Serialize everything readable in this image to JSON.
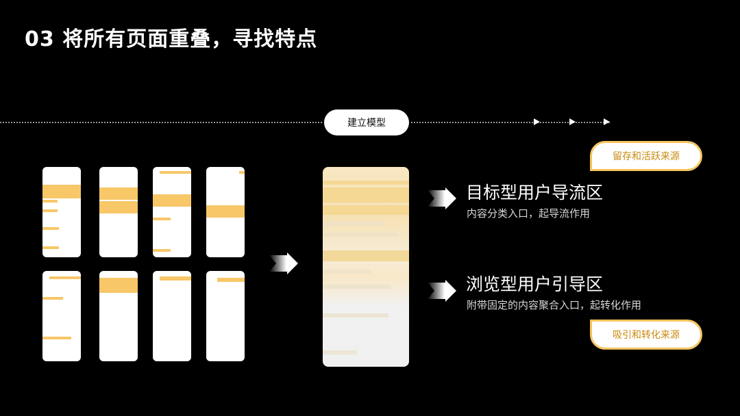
{
  "title": "03 将所有页面重叠，寻找特点",
  "flow": {
    "pill_label": "建立模型"
  },
  "zones": [
    {
      "heading": "目标型用户导流区",
      "desc": "内容分类入口，起导流作用",
      "tag": "留存和活跃来源"
    },
    {
      "heading": "浏览型用户引导区",
      "desc": "附带固定的内容聚合入口，起转化作用",
      "tag": "吸引和转化来源"
    }
  ],
  "colors": {
    "background": "#000000",
    "accent": "#f7c768",
    "tag_text": "#c98a0d"
  },
  "icons": [
    "motion-arrow-icon",
    "small-arrow-icon"
  ]
}
